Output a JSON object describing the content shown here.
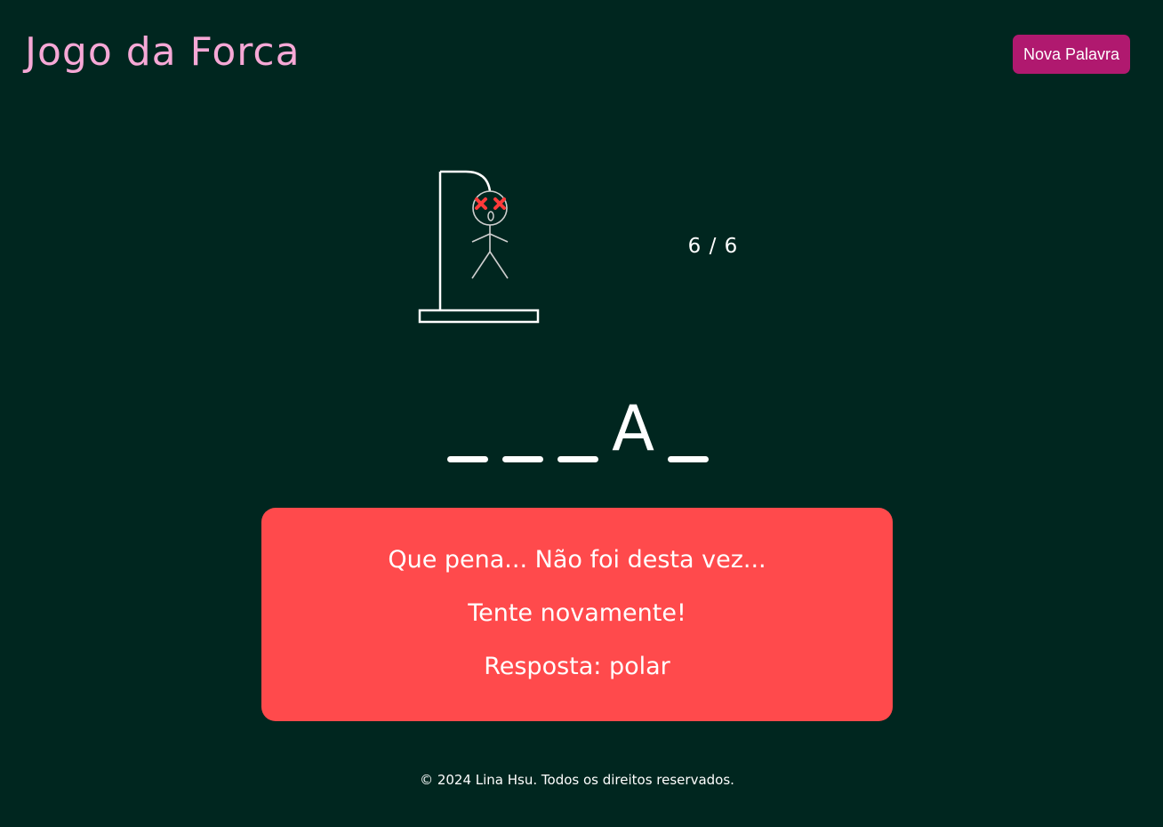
{
  "header": {
    "title": "Jogo da Forca",
    "new_word_label": "Nova Palavra"
  },
  "game": {
    "errors": 6,
    "max_errors": 6,
    "counter_text": "6 / 6",
    "word_slots": [
      {
        "letter": "",
        "revealed": false
      },
      {
        "letter": "",
        "revealed": false
      },
      {
        "letter": "",
        "revealed": false
      },
      {
        "letter": "A",
        "revealed": true
      },
      {
        "letter": "",
        "revealed": false
      }
    ]
  },
  "result": {
    "line1": "Que pena... Não foi desta vez...",
    "line2": "Tente novamente!",
    "line3": "Resposta: polar"
  },
  "footer": {
    "text": "© 2024 Lina Hsu. Todos os direitos reservados."
  },
  "colors": {
    "background": "#00261f",
    "title": "#f6a8d6",
    "button": "#b0196f",
    "result_box": "#ff4a4c",
    "dead_eyes": "#ff3b3b"
  }
}
